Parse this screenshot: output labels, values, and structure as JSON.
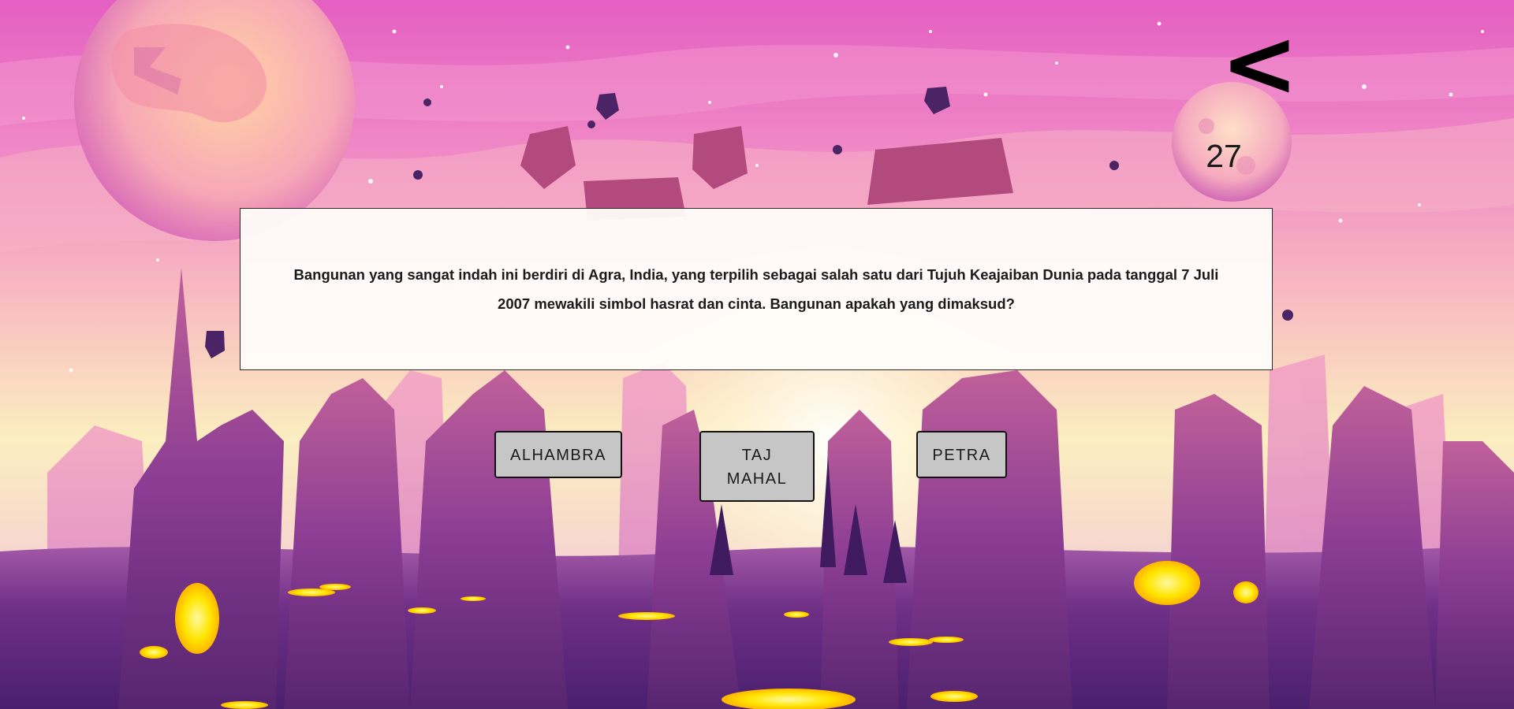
{
  "game": {
    "back_label": "<",
    "score": "27",
    "question": "Bangunan yang sangat indah ini berdiri di Agra, India, yang terpilih sebagai salah satu dari Tujuh Keajaiban Dunia pada tanggal 7 Juli 2007 mewakili simbol hasrat dan cinta. Bangunan apakah yang dimaksud?",
    "answers": [
      {
        "label": "ALHAMBRA"
      },
      {
        "label": "TAJ MAHAL"
      },
      {
        "label": "PETRA"
      }
    ]
  },
  "colors": {
    "sky_top": "#e65fc0",
    "sky_mid": "#f5a8c2",
    "horizon": "#fbf1b5",
    "rock_purple": "#7a3a8e",
    "ground_dark": "#4a1f6e",
    "lava_yellow": "#ffe600",
    "button_grey": "#c6c6c6"
  }
}
